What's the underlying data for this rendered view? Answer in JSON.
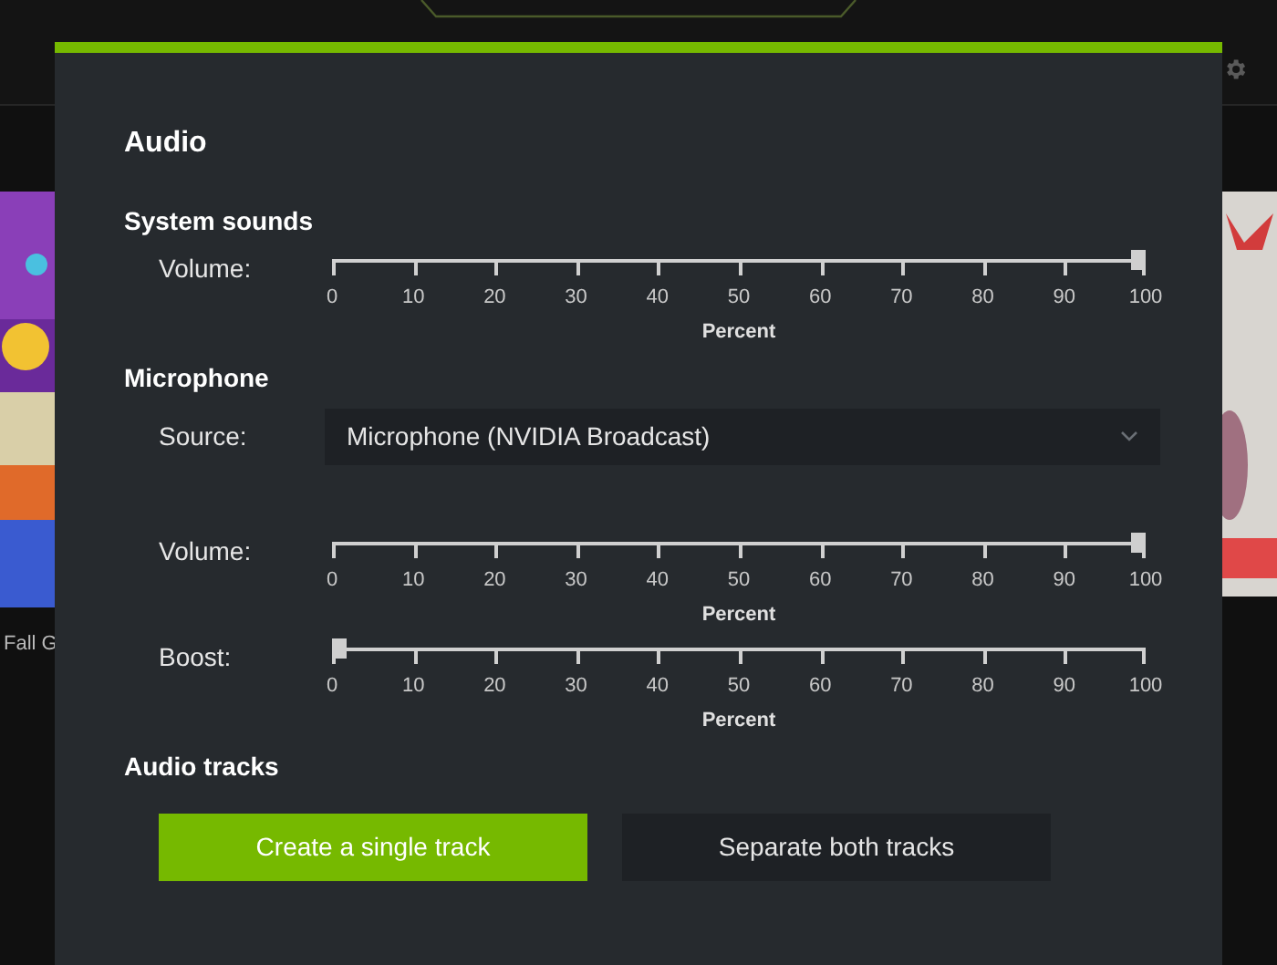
{
  "background": {
    "caption": "Fall G"
  },
  "dialog": {
    "title": "Audio",
    "sections": [
      {
        "heading": "System sounds",
        "rows": [
          {
            "kind": "slider",
            "label": "Volume:",
            "level": 1,
            "ticks": [
              "0",
              "10",
              "20",
              "30",
              "40",
              "50",
              "60",
              "70",
              "80",
              "90",
              "100"
            ],
            "axis_label": "Percent"
          }
        ]
      },
      {
        "heading": "Microphone",
        "rows": [
          {
            "kind": "dropdown",
            "label": "Source:",
            "value": "Microphone (NVIDIA Broadcast)"
          },
          {
            "kind": "slider",
            "label": "Volume:",
            "level": 1,
            "ticks": [
              "0",
              "10",
              "20",
              "30",
              "40",
              "50",
              "60",
              "70",
              "80",
              "90",
              "100"
            ],
            "axis_label": "Percent"
          },
          {
            "kind": "slider",
            "label": "Boost:",
            "level": 0,
            "ticks": [
              "0",
              "10",
              "20",
              "30",
              "40",
              "50",
              "60",
              "70",
              "80",
              "90",
              "100"
            ],
            "axis_label": "Percent"
          }
        ]
      },
      {
        "heading": "Audio tracks",
        "rows": [
          {
            "kind": "buttons",
            "options": [
              {
                "label": "Create a single track",
                "selected": true
              },
              {
                "label": "Separate both tracks",
                "selected": false
              }
            ]
          }
        ]
      }
    ]
  }
}
